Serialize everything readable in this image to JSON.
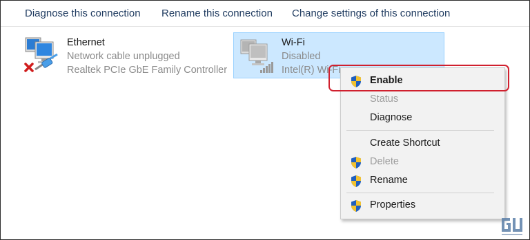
{
  "toolbar": {
    "diagnose": "Diagnose this connection",
    "rename": "Rename this connection",
    "change_settings": "Change settings of this connection"
  },
  "adapters": [
    {
      "name": "Ethernet",
      "status": "Network cable unplugged",
      "device": "Realtek PCIe GbE Family Controller",
      "status_icon": "red-x-icon"
    },
    {
      "name": "Wi-Fi",
      "status": "Disabled",
      "device": "Intel(R) Wi-Fi",
      "status_icon": "signal-bars-icon",
      "selected": true
    }
  ],
  "context_menu": {
    "items": [
      {
        "label": "Enable",
        "shield": true,
        "disabled": false,
        "bold": true,
        "highlighted": true
      },
      {
        "label": "Status",
        "shield": false,
        "disabled": true
      },
      {
        "label": "Diagnose",
        "shield": false,
        "disabled": false
      },
      {
        "label": "Create Shortcut",
        "shield": false,
        "disabled": false
      },
      {
        "label": "Delete",
        "shield": true,
        "disabled": true
      },
      {
        "label": "Rename",
        "shield": true,
        "disabled": false
      },
      {
        "label": "Properties",
        "shield": true,
        "disabled": false
      }
    ]
  },
  "colors": {
    "selection_bg": "#cce8ff",
    "highlight_border": "#d0202e",
    "toolbar_text": "#1e3a5f",
    "menu_bg": "#f2f2f2"
  },
  "watermark": {
    "logo": "gadgets-to-use-logo"
  }
}
